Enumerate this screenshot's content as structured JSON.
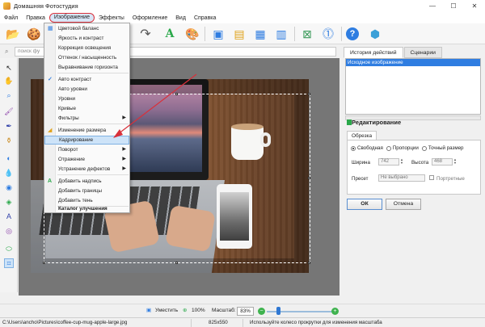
{
  "window": {
    "title": "Домашняя Фотостудия",
    "min": "—",
    "max": "☐",
    "close": "✕"
  },
  "menu": [
    "Файл",
    "Правка",
    "Изображение",
    "Эффекты",
    "Оформление",
    "Вид",
    "Справка"
  ],
  "search": {
    "placeholder": "поиск фу"
  },
  "dropdown": [
    {
      "label": "Цветовой баланс",
      "icon": "color-balance-icon"
    },
    {
      "label": "Яркость и контраст"
    },
    {
      "label": "Коррекция освещения"
    },
    {
      "label": "Оттенок / насыщенность"
    },
    {
      "label": "Выравнивание горизонта"
    },
    {
      "label": "Авто контраст",
      "checked": true
    },
    {
      "label": "Авто уровни"
    },
    {
      "label": "Уровни"
    },
    {
      "label": "Кривые"
    },
    {
      "label": "Фильтры",
      "submenu": true
    },
    {
      "label": "Изменение размера",
      "icon": "resize-icon"
    },
    {
      "label": "Кадрирование",
      "highlighted": true
    },
    {
      "label": "Поворот",
      "submenu": true
    },
    {
      "label": "Отражение",
      "submenu": true
    },
    {
      "label": "Устранение дефектов",
      "submenu": true
    },
    {
      "label": "Добавить надпись",
      "icon": "text-icon"
    },
    {
      "label": "Добавить границы"
    },
    {
      "label": "Добавить тень"
    },
    {
      "label": "Каталог улучшения",
      "bold": true
    }
  ],
  "panel": {
    "tabs": [
      "История действий",
      "Сценарии"
    ],
    "history": [
      "Исходное изображение"
    ],
    "edit_title": "Редактирование",
    "subtab": "Обрезка",
    "radios": [
      "Свободная",
      "Пропорции",
      "Точный размер"
    ],
    "width_label": "Ширина",
    "width_value": "742",
    "height_label": "Высота",
    "height_value": "468",
    "preset_label": "Пресет",
    "preset_value": "Не выбрано",
    "portrait_label": "Портретные",
    "ok": "ОК",
    "cancel": "Отмена"
  },
  "zoombar": {
    "fit": "Уместить",
    "p100": "100%",
    "scale_label": "Масштаб:",
    "scale_value": "83%"
  },
  "status": {
    "path": "C:\\Users\\ancho\\Pictures\\coffee-cup-mug-apple-large.jpg",
    "size": "825x550",
    "hint": "Используйте колесо прокрутки для изменения масштаба"
  },
  "colors": {
    "accent": "#2f7de1",
    "highlight_ring": "#d9303a",
    "arrow": "#d9303a",
    "menu_hl": "#cde3f8"
  }
}
